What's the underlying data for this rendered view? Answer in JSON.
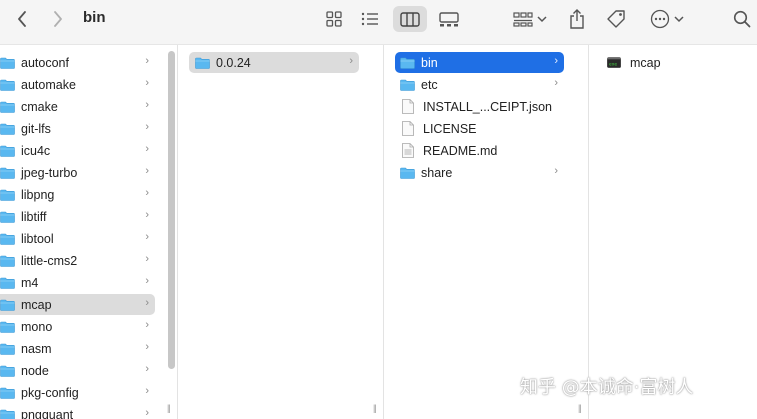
{
  "window": {
    "title": "bin"
  },
  "toolbar": {
    "icons": [
      "back-icon",
      "forward-icon",
      "icon-view-icon",
      "list-view-icon",
      "column-view-icon",
      "gallery-view-icon",
      "group-icon",
      "share-icon",
      "tag-icon",
      "more-icon",
      "search-icon"
    ]
  },
  "columns": {
    "col1": [
      {
        "label": "autoconf",
        "has_children": true
      },
      {
        "label": "automake",
        "has_children": true
      },
      {
        "label": "cmake",
        "has_children": true
      },
      {
        "label": "git-lfs",
        "has_children": true
      },
      {
        "label": "icu4c",
        "has_children": true
      },
      {
        "label": "jpeg-turbo",
        "has_children": true
      },
      {
        "label": "libpng",
        "has_children": true
      },
      {
        "label": "libtiff",
        "has_children": true
      },
      {
        "label": "libtool",
        "has_children": true
      },
      {
        "label": "little-cms2",
        "has_children": true
      },
      {
        "label": "m4",
        "has_children": true
      },
      {
        "label": "mcap",
        "has_children": true,
        "selected": true
      },
      {
        "label": "mono",
        "has_children": true
      },
      {
        "label": "nasm",
        "has_children": true
      },
      {
        "label": "node",
        "has_children": true
      },
      {
        "label": "pkg-config",
        "has_children": true
      },
      {
        "label": "pngquant",
        "has_children": true
      }
    ],
    "col2": [
      {
        "label": "0.0.24",
        "has_children": true,
        "selected": true
      }
    ],
    "col3": [
      {
        "label": "bin",
        "kind": "folder",
        "has_children": true,
        "selected": true
      },
      {
        "label": "etc",
        "kind": "folder",
        "has_children": true
      },
      {
        "label": "INSTALL_...CEIPT.json",
        "kind": "file"
      },
      {
        "label": "LICENSE",
        "kind": "file"
      },
      {
        "label": "README.md",
        "kind": "file"
      },
      {
        "label": "share",
        "kind": "folder",
        "has_children": true
      }
    ],
    "col4": [
      {
        "label": "mcap",
        "kind": "executable"
      }
    ]
  },
  "watermark": "知乎 @本诚命·富树人",
  "colors": {
    "selection_blue": "#1f6fe5",
    "selection_gray": "#dcdcdc",
    "folder_blue": "#5ab8f0"
  }
}
